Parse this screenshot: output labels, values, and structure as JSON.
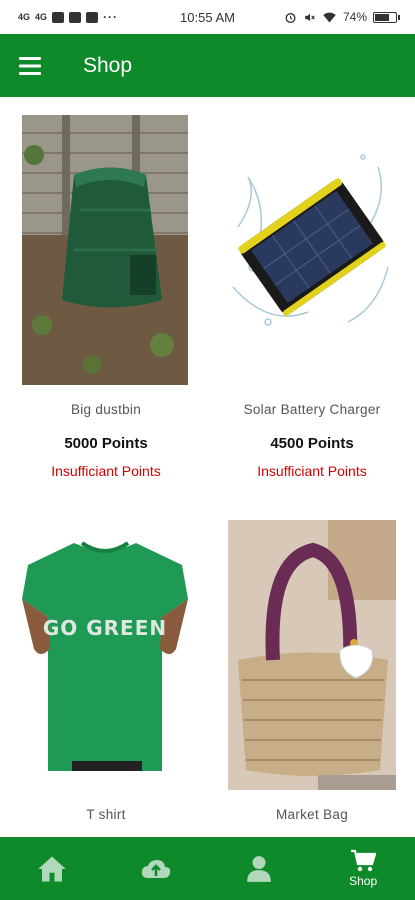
{
  "status_bar": {
    "time": "10:55 AM",
    "battery": "74%",
    "battery_level": 0.74,
    "left_icons": [
      "signal-icon",
      "signal-icon",
      "messenger-icon",
      "youtube-icon",
      "app-icon",
      "more-dots"
    ],
    "right_icons": [
      "alarm-icon",
      "mute-icon",
      "wifi-icon",
      "battery-icon"
    ]
  },
  "app_bar": {
    "title": "Shop",
    "menu_icon": "hamburger-menu-icon",
    "color": "#0f8a2b"
  },
  "products": [
    {
      "name": "Big dustbin",
      "points": "5000 Points",
      "status": "Insufficiant Points",
      "image": "green compost bin in garden"
    },
    {
      "name": "Solar Battery Charger",
      "points": "4500 Points",
      "status": "Insufficiant Points",
      "image": "solar power bank with water splash"
    },
    {
      "name": "T shirt",
      "image": "green t-shirt with GO GREEN print",
      "image_text": "GO GREEN"
    },
    {
      "name": "Market Bag",
      "image": "woven straw bag with purple handle"
    }
  ],
  "bottom_nav": {
    "items": [
      {
        "icon": "home-icon",
        "label": ""
      },
      {
        "icon": "cloud-upload-icon",
        "label": ""
      },
      {
        "icon": "person-icon",
        "label": ""
      },
      {
        "icon": "shopping-cart-icon",
        "label": "Shop",
        "active": true
      }
    ]
  },
  "colors": {
    "primary": "#0f8a2b",
    "warning_text": "#d30000",
    "background": "#ffffff"
  }
}
